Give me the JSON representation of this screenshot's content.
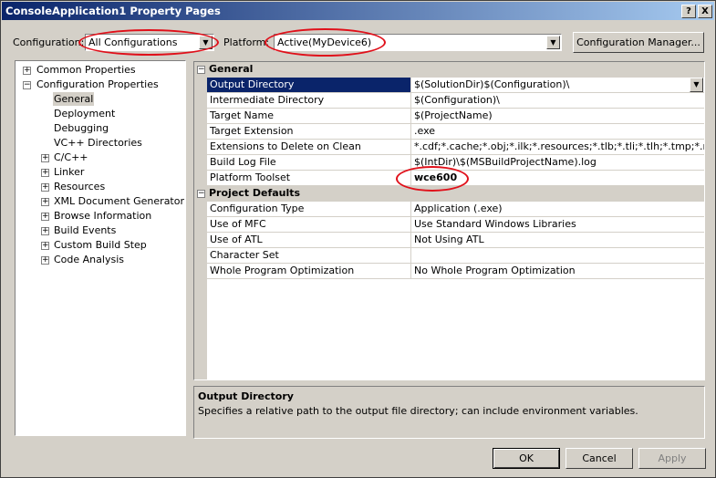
{
  "window": {
    "title": "ConsoleApplication1 Property Pages",
    "help_btn": "?",
    "close_btn": "X"
  },
  "toolbar": {
    "config_label": "Configuration:",
    "config_value": "All Configurations",
    "platform_label": "Platform:",
    "platform_value": "Active(MyDevice6)",
    "config_manager_label": "Configuration Manager..."
  },
  "tree": {
    "items": [
      {
        "label": "Common Properties"
      },
      {
        "label": "Configuration Properties"
      },
      {
        "label": "General"
      },
      {
        "label": "Deployment"
      },
      {
        "label": "Debugging"
      },
      {
        "label": "VC++ Directories"
      },
      {
        "label": "C/C++"
      },
      {
        "label": "Linker"
      },
      {
        "label": "Resources"
      },
      {
        "label": "XML Document Generator"
      },
      {
        "label": "Browse Information"
      },
      {
        "label": "Build Events"
      },
      {
        "label": "Custom Build Step"
      },
      {
        "label": "Code Analysis"
      }
    ]
  },
  "grid": {
    "cat_general": "General",
    "cat_defaults": "Project Defaults",
    "rows": [
      {
        "name": "Output Directory",
        "value": "$(SolutionDir)$(Configuration)\\"
      },
      {
        "name": "Intermediate Directory",
        "value": "$(Configuration)\\"
      },
      {
        "name": "Target Name",
        "value": "$(ProjectName)"
      },
      {
        "name": "Target Extension",
        "value": ".exe"
      },
      {
        "name": "Extensions to Delete on Clean",
        "value": "*.cdf;*.cache;*.obj;*.ilk;*.resources;*.tlb;*.tli;*.tlh;*.tmp;*.rsp;"
      },
      {
        "name": "Build Log File",
        "value": "$(IntDir)\\$(MSBuildProjectName).log"
      },
      {
        "name": "Platform Toolset",
        "value": "wce600"
      },
      {
        "name": "Configuration Type",
        "value": "Application (.exe)"
      },
      {
        "name": "Use of MFC",
        "value": "Use Standard Windows Libraries"
      },
      {
        "name": "Use of ATL",
        "value": "Not Using ATL"
      },
      {
        "name": "Character Set",
        "value": ""
      },
      {
        "name": "Whole Program Optimization",
        "value": "No Whole Program Optimization"
      }
    ]
  },
  "description": {
    "title": "Output Directory",
    "text": "Specifies a relative path to the output file directory; can include environment variables."
  },
  "buttons": {
    "ok": "OK",
    "cancel": "Cancel",
    "apply": "Apply"
  },
  "colors": {
    "highlight": "#0a246a",
    "annotation": "#e0101a"
  }
}
